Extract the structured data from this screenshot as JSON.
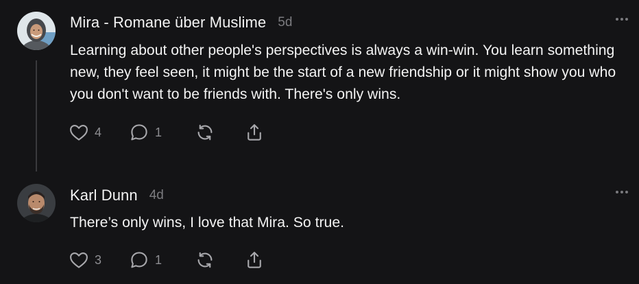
{
  "posts": [
    {
      "author": "Mira - Romane über Muslime",
      "time": "5d",
      "text": "Learning about other people's perspectives is always a win-win. You learn something new, they feel seen, it might be the start of a new friendship or it might show you who you don't want to be friends with. There's only wins.",
      "likes": "4",
      "replies": "1"
    },
    {
      "author": "Karl Dunn",
      "time": "4d",
      "text": "There’s only wins, I love that Mira. So true.",
      "likes": "3",
      "replies": "1"
    }
  ],
  "icons": {
    "like": "heart-icon",
    "reply": "comment-icon",
    "repost": "repost-icon",
    "share": "share-icon",
    "more": "more-icon"
  },
  "colors": {
    "background": "#141416",
    "text": "#f3f3f3",
    "muted": "#7c7c80",
    "icon": "#a7a7ab"
  }
}
